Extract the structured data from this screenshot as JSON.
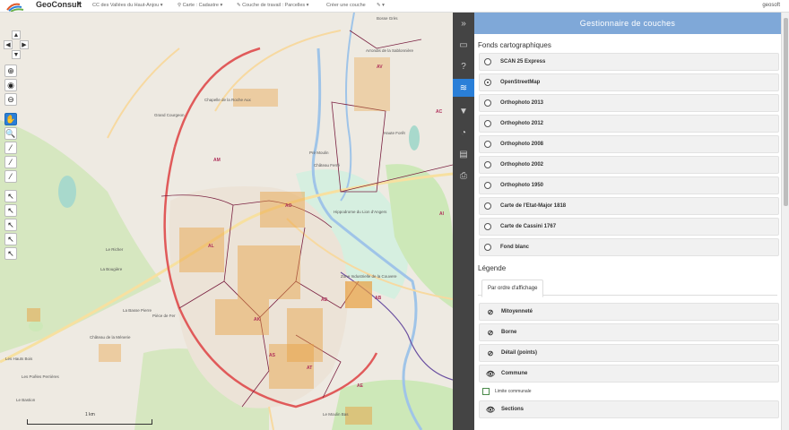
{
  "header": {
    "brand": "GeoConsult",
    "menus": [
      {
        "label": "CC des Vallées du Haut-Anjou"
      },
      {
        "label": "Carte : Cadastre"
      },
      {
        "label": "Couche de travail : Parcelles"
      },
      {
        "label": "Créer une couche"
      },
      {
        "label": ""
      }
    ],
    "user": "geosoft"
  },
  "map": {
    "labels": [
      {
        "text": "Bosse Grès"
      },
      {
        "text": "Arrondis de la Sablonnière"
      },
      {
        "text": "Haute Forêt"
      },
      {
        "text": "Grand Courgeon"
      },
      {
        "text": "Chapelle de la Roche Aux"
      },
      {
        "text": "Pré Moulin"
      },
      {
        "text": "Château Ferré"
      },
      {
        "text": "Hippodrome du Lion d'Angers"
      },
      {
        "text": "Zone Industrielle de la Couvere"
      },
      {
        "text": "Le Richer"
      },
      {
        "text": "La Bougière"
      },
      {
        "text": "La Basse Pierre"
      },
      {
        "text": "Pièce de Fer"
      },
      {
        "text": "Château de la Ménerie"
      },
      {
        "text": "Les Hauts Bois"
      },
      {
        "text": "Les Poêles Perrières"
      },
      {
        "text": "Le Bastion"
      },
      {
        "text": "Le Moulin Bas"
      }
    ],
    "sections": [
      "AV",
      "AC",
      "AM",
      "AO",
      "AL",
      "AK",
      "AB",
      "AS",
      "AT",
      "AD",
      "AI",
      "AE"
    ],
    "scale_label": "1 km"
  },
  "panel": {
    "title": "Gestionnaire de couches",
    "basemaps_title": "Fonds cartographiques",
    "basemaps": [
      {
        "label": "SCAN 25 Express",
        "selected": false
      },
      {
        "label": "OpenStreetMap",
        "selected": true
      },
      {
        "label": "Orthophoto 2013",
        "selected": false
      },
      {
        "label": "Orthophoto 2012",
        "selected": false
      },
      {
        "label": "Orthophoto 2008",
        "selected": false
      },
      {
        "label": "Orthophoto 2002",
        "selected": false
      },
      {
        "label": "Orthophoto 1950",
        "selected": false
      },
      {
        "label": "Carte de l'Etat-Major 1818",
        "selected": false
      },
      {
        "label": "Carte de Cassini 1767",
        "selected": false
      },
      {
        "label": "Fond blanc",
        "selected": false
      }
    ],
    "legend_title": "Légende",
    "legend_tab": "Par ordre d'affichage",
    "legend_items": [
      {
        "label": "Mitoyenneté",
        "visible": false
      },
      {
        "label": "Borne",
        "visible": false
      },
      {
        "label": "Détail (points)",
        "visible": false
      },
      {
        "label": "Commune",
        "visible": true
      },
      {
        "label": "Sections",
        "visible": true
      }
    ],
    "legend_sub": {
      "label": "Limite communale",
      "color": "#4a8a4a"
    }
  }
}
